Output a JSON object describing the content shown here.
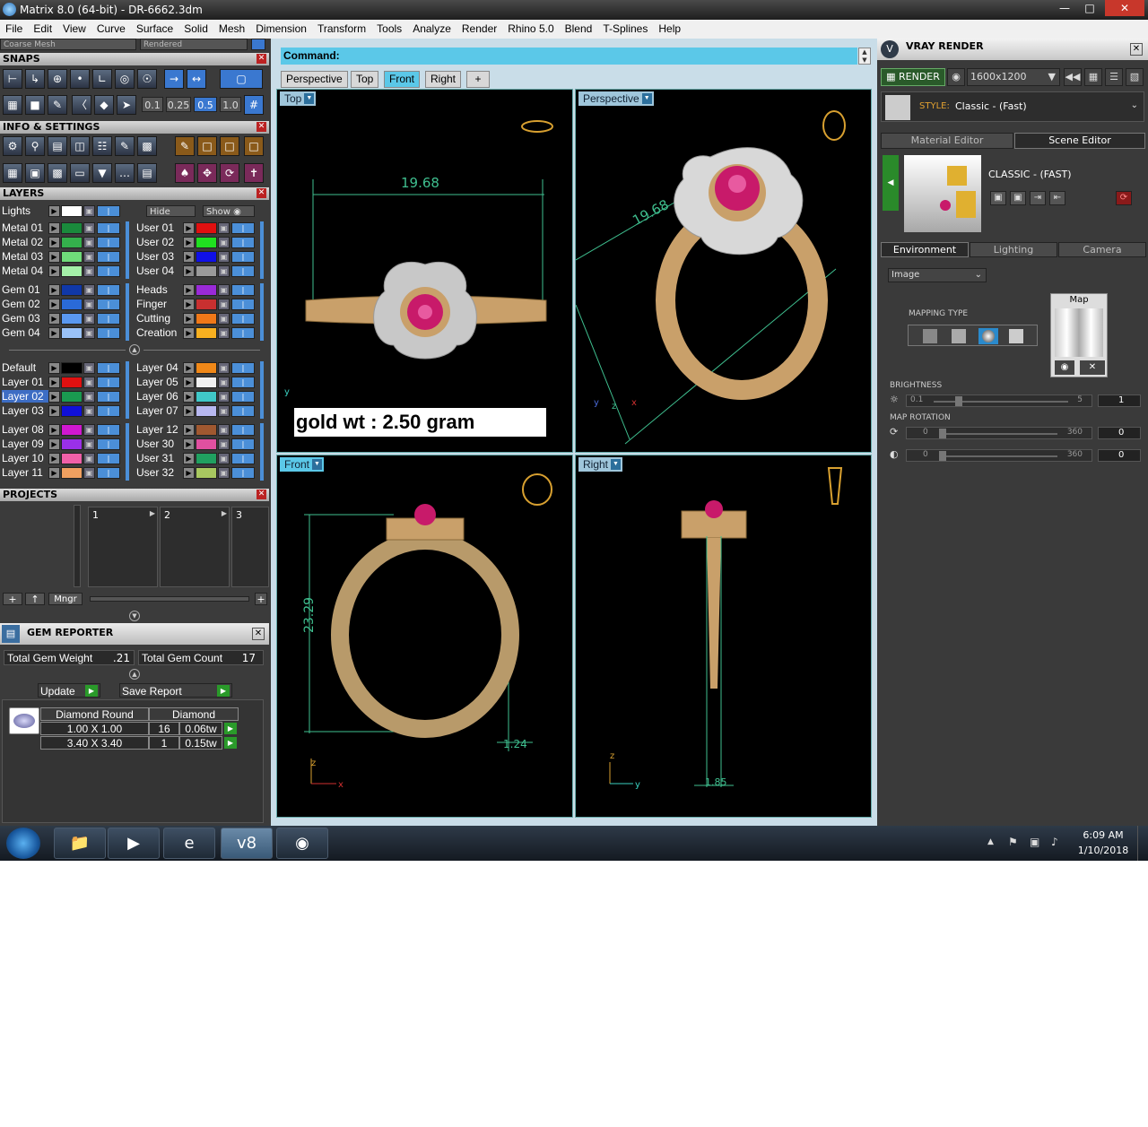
{
  "window": {
    "title": "Matrix 8.0 (64-bit) - DR-6662.3dm"
  },
  "menu": [
    "File",
    "Edit",
    "View",
    "Curve",
    "Surface",
    "Solid",
    "Mesh",
    "Dimension",
    "Transform",
    "Tools",
    "Analyze",
    "Render",
    "Rhino 5.0",
    "Blend",
    "T-Splines",
    "Help"
  ],
  "left": {
    "mesh_mode": "Coarse Mesh",
    "display_mode": "Rendered",
    "snaps_title": "SNAPS",
    "snap_values": [
      "0.1",
      "0.25",
      "0.5",
      "1.0"
    ],
    "info_title": "INFO & SETTINGS",
    "layers_title": "LAYERS",
    "lights_label": "Lights",
    "hide_label": "Hide",
    "show_label": "Show",
    "layers_left_a": [
      {
        "name": "Metal 01",
        "color": "#1a8a3c"
      },
      {
        "name": "Metal 02",
        "color": "#34b04c"
      },
      {
        "name": "Metal 03",
        "color": "#6fdc7a"
      },
      {
        "name": "Metal 04",
        "color": "#a4f0a8"
      }
    ],
    "layers_right_a": [
      {
        "name": "User 01",
        "color": "#e01010"
      },
      {
        "name": "User 02",
        "color": "#20e020"
      },
      {
        "name": "User 03",
        "color": "#1010e8"
      },
      {
        "name": "User 04",
        "color": "#9a9a9a"
      }
    ],
    "layers_left_b": [
      {
        "name": "Gem 01",
        "color": "#1038a8"
      },
      {
        "name": "Gem 02",
        "color": "#2a6ad8"
      },
      {
        "name": "Gem 03",
        "color": "#5a98f0"
      },
      {
        "name": "Gem 04",
        "color": "#9ac2f8"
      }
    ],
    "layers_right_b": [
      {
        "name": "Heads",
        "color": "#9a2ad8"
      },
      {
        "name": "Finger",
        "color": "#c83030"
      },
      {
        "name": "Cutting",
        "color": "#f07818"
      },
      {
        "name": "Creation",
        "color": "#f8b020"
      }
    ],
    "layers_left_c": [
      {
        "name": "Default",
        "color": "#000000"
      },
      {
        "name": "Layer 01",
        "color": "#e01010"
      },
      {
        "name": "Layer 02",
        "color": "#1a9a50"
      },
      {
        "name": "Layer 03",
        "color": "#1010d8"
      }
    ],
    "layers_right_c": [
      {
        "name": "Layer 04",
        "color": "#f08818"
      },
      {
        "name": "Layer 05",
        "color": "#f0f0f0"
      },
      {
        "name": "Layer 06",
        "color": "#40c8c8"
      },
      {
        "name": "Layer 07",
        "color": "#b8b8f0"
      }
    ],
    "layers_left_d": [
      {
        "name": "Layer 08",
        "color": "#d018d0"
      },
      {
        "name": "Layer 09",
        "color": "#9a30e8"
      },
      {
        "name": "Layer 10",
        "color": "#f060a8"
      },
      {
        "name": "Layer 11",
        "color": "#f0a060"
      }
    ],
    "layers_right_d": [
      {
        "name": "Layer 12",
        "color": "#a05830"
      },
      {
        "name": "User 30",
        "color": "#e050a0"
      },
      {
        "name": "User 31",
        "color": "#20a060"
      },
      {
        "name": "User 32",
        "color": "#a8c860"
      }
    ],
    "projects_title": "PROJECTS",
    "project_slots": [
      "1",
      "2",
      "3"
    ],
    "mngr_label": "Mngr",
    "gem_reporter_title": "GEM REPORTER",
    "total_gem_weight_label": "Total Gem Weight",
    "total_gem_weight": ".21",
    "total_gem_count_label": "Total Gem Count",
    "total_gem_count": "17",
    "update_label": "Update",
    "save_report_label": "Save Report",
    "gem_table_headers": [
      "Diamond Round",
      "Diamond"
    ],
    "gem_rows": [
      {
        "size": "1.00 X 1.00",
        "count": "16",
        "weight": "0.06tw"
      },
      {
        "size": "3.40 X 3.40",
        "count": "1",
        "weight": "0.15tw"
      }
    ]
  },
  "center": {
    "command_label": "Command:",
    "tabs": [
      "Perspective",
      "Top",
      "Front",
      "Right",
      "+"
    ],
    "active_tab": "Front",
    "viewports": {
      "top": {
        "label": "Top",
        "dimension": "19.68",
        "note": "gold wt : 2.50 gram"
      },
      "perspective": {
        "label": "Perspective",
        "dimension": "19.68"
      },
      "front": {
        "label": "Front",
        "dim_height": "23.29",
        "dim_width": "1.24"
      },
      "right": {
        "label": "Right",
        "dim_width": "1.85"
      }
    },
    "axes": {
      "top": "y",
      "persp": [
        "y",
        "z",
        "x"
      ],
      "front": [
        "z",
        "x"
      ],
      "right": [
        "z",
        "y"
      ]
    }
  },
  "right": {
    "title": "VRAY RENDER",
    "render_label": "RENDER",
    "resolution": "1600x1200",
    "style_prefix": "STYLE:",
    "style_value": "Classic - (Fast)",
    "tab_material": "Material Editor",
    "tab_scene": "Scene Editor",
    "scene_name": "CLASSIC - (FAST)",
    "env_tabs": [
      "Environment",
      "Lighting",
      "Camera"
    ],
    "env_source": "Image",
    "map_label": "Map",
    "mapping_type_label": "MAPPING TYPE",
    "brightness_label": "BRIGHTNESS",
    "brightness_min": "0.1",
    "brightness_max": "5",
    "brightness_value": "1",
    "map_rotation_label": "MAP ROTATION",
    "rot1_min": "0",
    "rot1_max": "360",
    "rot1_value": "0",
    "rot2_min": "0",
    "rot2_max": "360",
    "rot2_value": "0"
  },
  "taskbar": {
    "time": "6:09 AM",
    "date": "1/10/2018",
    "v8_label": "v8"
  }
}
